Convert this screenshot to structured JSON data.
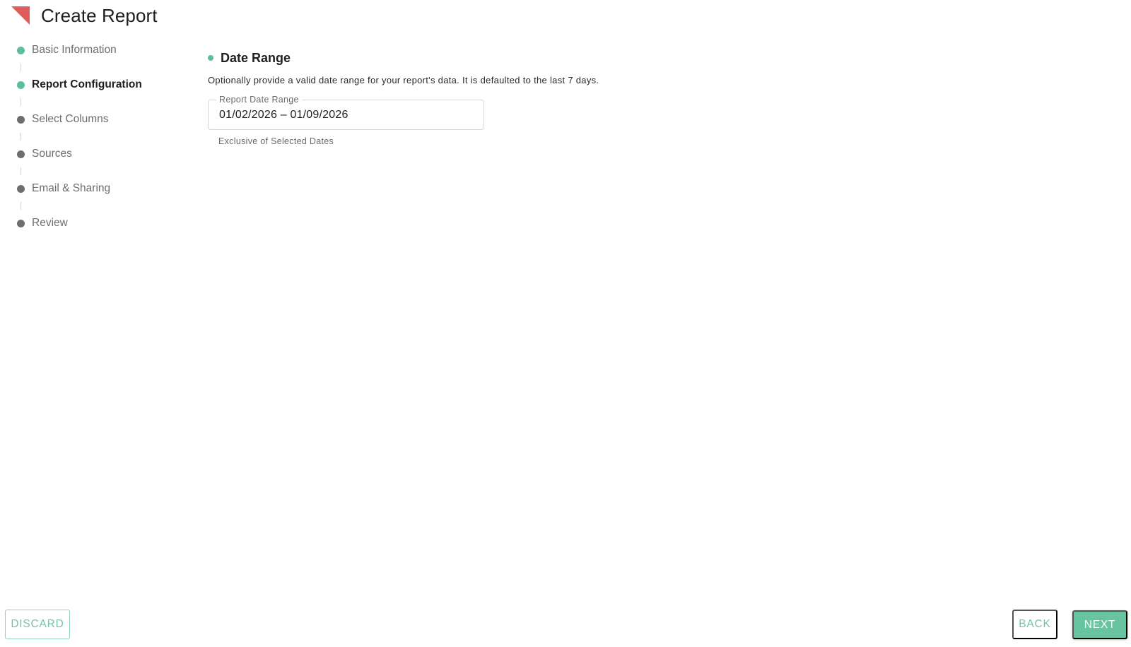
{
  "header": {
    "title": "Create Report",
    "logo_color": "#e05d5d"
  },
  "stepper": {
    "steps": [
      {
        "label": "Basic Information",
        "status": "done"
      },
      {
        "label": "Report Configuration",
        "status": "active"
      },
      {
        "label": "Select Columns",
        "status": "pending"
      },
      {
        "label": "Sources",
        "status": "pending"
      },
      {
        "label": "Email & Sharing",
        "status": "pending"
      },
      {
        "label": "Review",
        "status": "pending"
      }
    ]
  },
  "main": {
    "section_title": "Date Range",
    "description": "Optionally provide a valid date range for your report's data. It is defaulted to the last 7 days.",
    "date_field": {
      "label": "Report Date Range",
      "value": "01/02/2026 – 01/09/2026",
      "helper": "Exclusive of Selected Dates"
    }
  },
  "footer": {
    "discard_label": "DISCARD",
    "back_label": "BACK",
    "next_label": "NEXT"
  },
  "colors": {
    "accent": "#5cbf99",
    "pending": "#6e6e6e",
    "logo": "#e05d5d"
  }
}
